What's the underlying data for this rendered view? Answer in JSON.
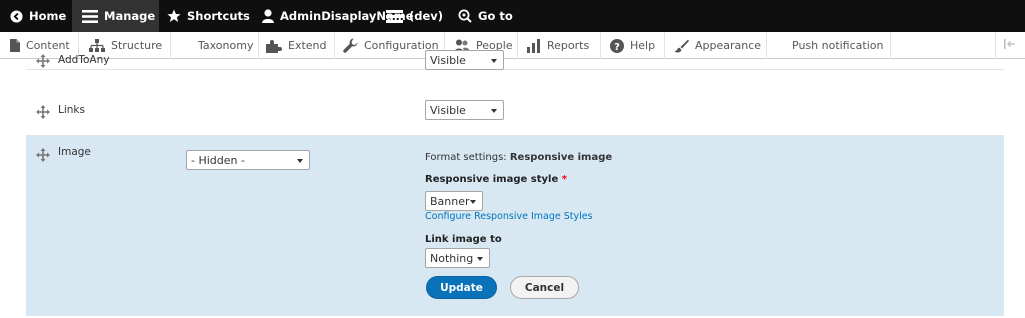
{
  "toolbar": {
    "home": "Home",
    "manage": "Manage",
    "shortcuts": "Shortcuts",
    "user": "AdminDisaplayName",
    "environment": "(dev)",
    "goto": "Go to"
  },
  "tray": {
    "items": [
      "Content",
      "Structure",
      "Taxonomy",
      "Extend",
      "Configuration",
      "People",
      "Reports",
      "Help",
      "Appearance",
      "Push notification"
    ]
  },
  "rows": {
    "addtoany": {
      "label": "AddToAny",
      "format": "Visible"
    },
    "links": {
      "label": "Links",
      "format": "Visible"
    },
    "image": {
      "label": "Image",
      "region": "- Hidden -",
      "format_settings_label": "Format settings:",
      "format_settings_value": "Responsive image",
      "style_label": "Responsive image style",
      "required_mark": "*",
      "style_value": "Banner",
      "configure_link": "Configure Responsive Image Styles",
      "link_label": "Link image to",
      "link_value": "Nothing",
      "update_button": "Update",
      "cancel_button": "Cancel"
    }
  },
  "colors": {
    "toolbar_bg": "#0f0f0f",
    "highlight_bg": "#d7e8f3",
    "primary": "#0a72b9",
    "link": "#0074bd"
  }
}
